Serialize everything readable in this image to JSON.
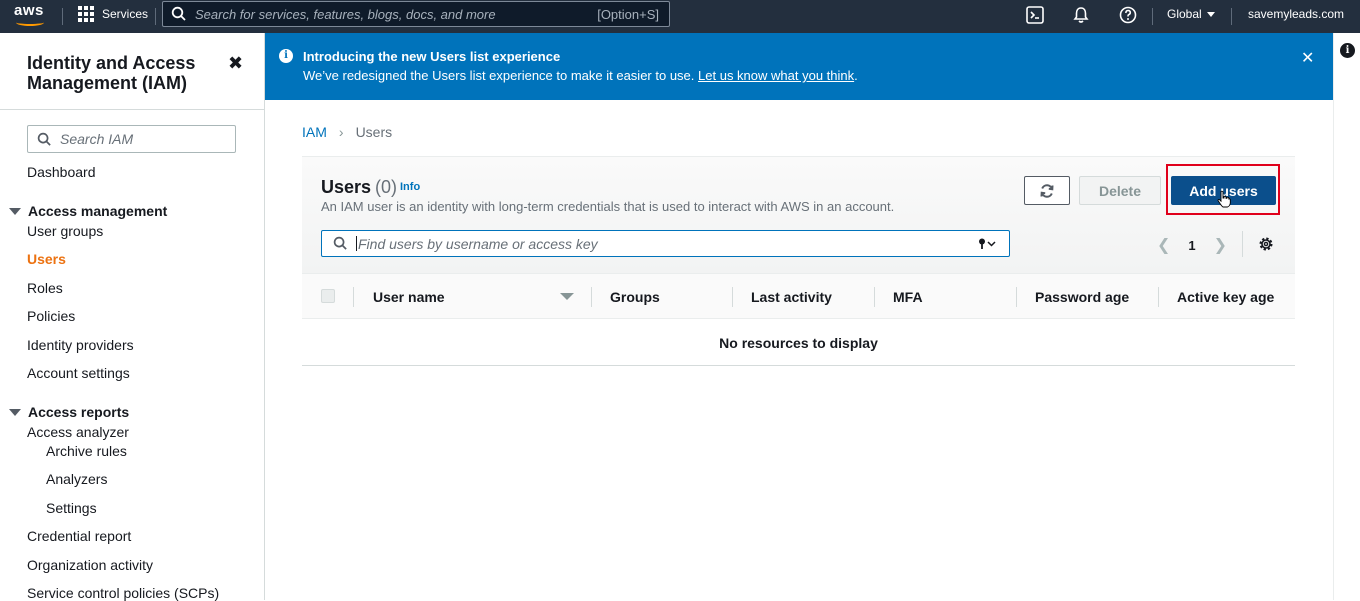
{
  "topnav": {
    "logo": "aws",
    "services_label": "Services",
    "search_placeholder": "Search for services, features, blogs, docs, and more",
    "search_shortcut": "[Option+S]",
    "region": "Global",
    "account": "savemyleads.com"
  },
  "sidebar": {
    "title": "Identity and Access Management (IAM)",
    "search_placeholder": "Search IAM",
    "dashboard": "Dashboard",
    "access_management": {
      "header": "Access management",
      "items": [
        "User groups",
        "Users",
        "Roles",
        "Policies",
        "Identity providers",
        "Account settings"
      ],
      "active": "Users"
    },
    "access_reports": {
      "header": "Access reports",
      "analyzer": "Access analyzer",
      "analyzer_items": [
        "Archive rules",
        "Analyzers",
        "Settings"
      ],
      "items": [
        "Credential report",
        "Organization activity",
        "Service control policies (SCPs)"
      ]
    }
  },
  "banner": {
    "title": "Introducing the new Users list experience",
    "body": "We’ve redesigned the Users list experience to make it easier to use.",
    "link": "Let us know what you think",
    "link_suffix": "."
  },
  "breadcrumb": {
    "root": "IAM",
    "current": "Users"
  },
  "users_panel": {
    "title": "Users",
    "count": "(0)",
    "info": "Info",
    "description": "An IAM user is an identity with long-term credentials that is used to interact with AWS in an account.",
    "delete_label": "Delete",
    "add_label": "Add users",
    "filter_placeholder": "Find users by username or access key",
    "page": "1",
    "columns": [
      "User name",
      "Groups",
      "Last activity",
      "MFA",
      "Password age",
      "Active key age"
    ],
    "empty_message": "No resources to display"
  },
  "colors": {
    "topnav_bg": "#232f3e",
    "banner_bg": "#0073bb",
    "active_nav": "#ec7211",
    "primary_button": "#0b4f8c",
    "highlight_box": "#e0001b"
  }
}
